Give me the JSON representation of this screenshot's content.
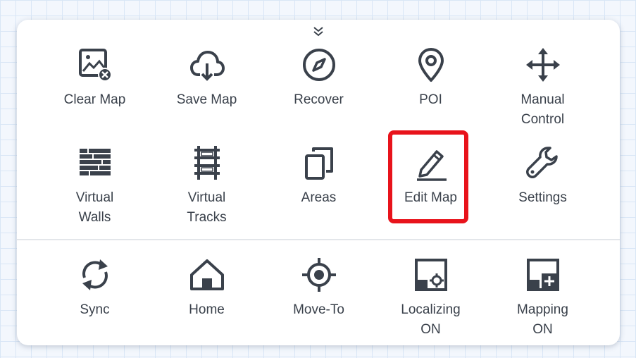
{
  "panel": {
    "top_items": [
      {
        "label": "Clear Map",
        "icon": "clear-map-icon"
      },
      {
        "label": "Save Map",
        "icon": "cloud-download-icon"
      },
      {
        "label": "Recover",
        "icon": "compass-icon"
      },
      {
        "label": "POI",
        "icon": "location-pin-icon"
      },
      {
        "label": "Manual\nControl",
        "icon": "move-arrows-icon"
      },
      {
        "label": "Virtual\nWalls",
        "icon": "brick-wall-icon"
      },
      {
        "label": "Virtual\nTracks",
        "icon": "rail-track-icon"
      },
      {
        "label": "Areas",
        "icon": "areas-icon"
      },
      {
        "label": "Edit Map",
        "icon": "pencil-icon"
      },
      {
        "label": "Settings",
        "icon": "wrench-icon"
      }
    ],
    "bottom_items": [
      {
        "label": "Sync",
        "icon": "sync-icon"
      },
      {
        "label": "Home",
        "icon": "home-icon"
      },
      {
        "label": "Move-To",
        "icon": "target-icon"
      },
      {
        "label": "Localizing\nON",
        "icon": "localizing-map-icon"
      },
      {
        "label": "Mapping\nON",
        "icon": "mapping-add-icon"
      }
    ]
  },
  "colors": {
    "icon": "#3a414b",
    "highlight": "#e8131b",
    "background": "#f3f7fd"
  }
}
